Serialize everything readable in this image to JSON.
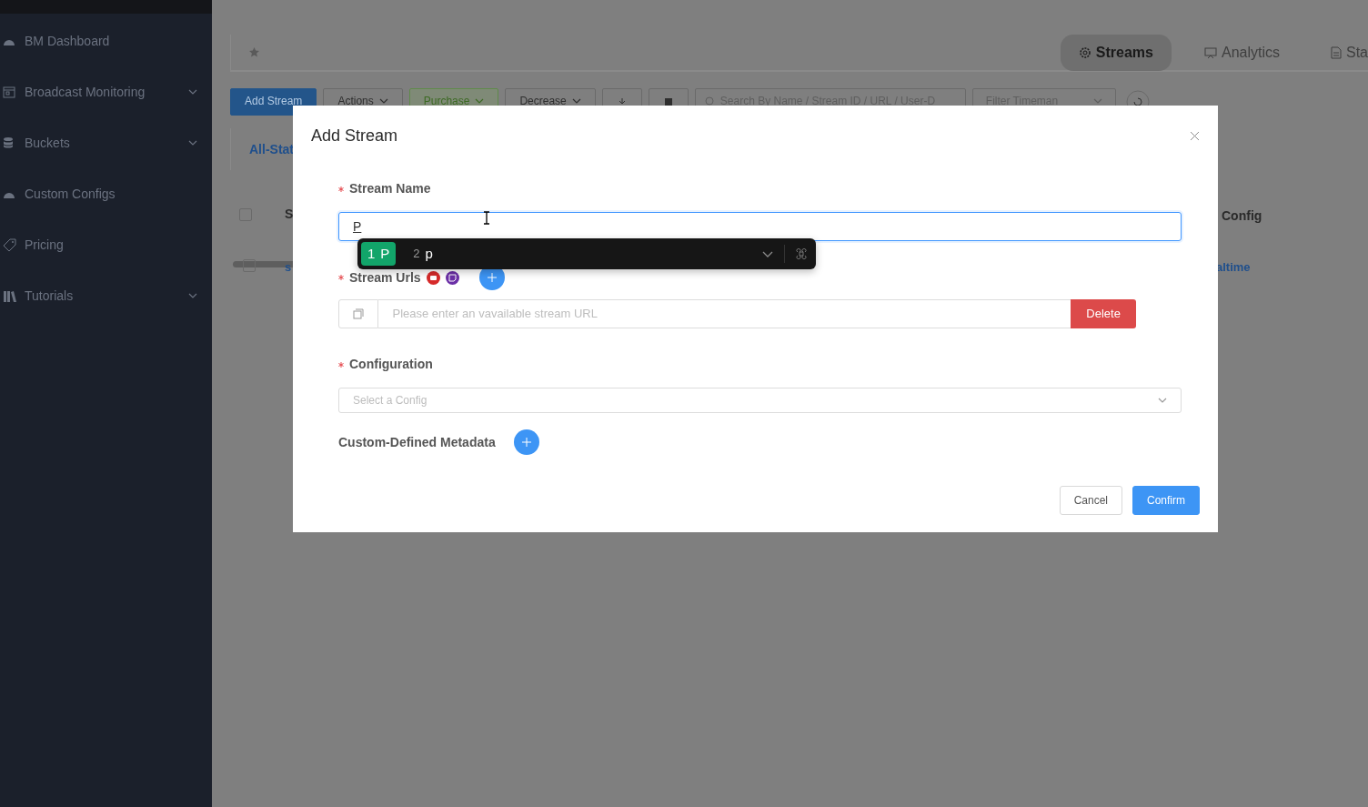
{
  "sidebar": {
    "items": [
      {
        "label": "BM Dashboard",
        "has_submenu": false
      },
      {
        "label": "Broadcast Monitoring",
        "has_submenu": true
      },
      {
        "label": "Buckets",
        "has_submenu": true
      },
      {
        "label": "Custom Configs",
        "has_submenu": false
      },
      {
        "label": "Pricing",
        "has_submenu": false
      },
      {
        "label": "Tutorials",
        "has_submenu": true
      }
    ]
  },
  "tabs": [
    {
      "label": "Streams",
      "selected": true
    },
    {
      "label": "Analytics",
      "selected": false
    },
    {
      "label": "Sta",
      "selected": false
    }
  ],
  "toolbar": {
    "buttons": [
      {
        "label": "Add Stream",
        "kind": "primary"
      },
      {
        "label": "Actions",
        "kind": "dropdown"
      },
      {
        "label": "Purchase",
        "kind": "success"
      },
      {
        "label": "Decrease",
        "kind": "dropdown"
      }
    ],
    "search": {
      "placeholder": "Search By Name / Stream ID / URL / User-D"
    },
    "filter": {
      "placeholder": "Filter Timeman"
    }
  },
  "status_tab": "All-Stat",
  "table": {
    "columns": [
      "S",
      "Config"
    ],
    "header_checked": false,
    "rows": [
      {
        "checked": false,
        "cells": [
          "s",
          "altime"
        ]
      }
    ]
  },
  "dialog": {
    "title": "Add Stream",
    "stream_name": {
      "label": "Stream Name",
      "required": true,
      "value": "P",
      "composing": true
    },
    "ime_popup": {
      "candidates": [
        {
          "index": "1",
          "text": "P",
          "selected": true
        },
        {
          "index": "2",
          "text": "p",
          "selected": false
        }
      ]
    },
    "stream_urls": {
      "label": "Stream Urls",
      "required": true,
      "placeholder": "Please enter an vavailable stream URL",
      "delete_label": "Delete"
    },
    "configuration": {
      "label": "Configuration",
      "required": true,
      "placeholder": "Select a Config"
    },
    "metadata": {
      "label": "Custom-Defined Metadata"
    },
    "buttons": [
      {
        "label": "Cancel",
        "kind": "default"
      },
      {
        "label": "Confirm",
        "kind": "primary"
      }
    ]
  }
}
